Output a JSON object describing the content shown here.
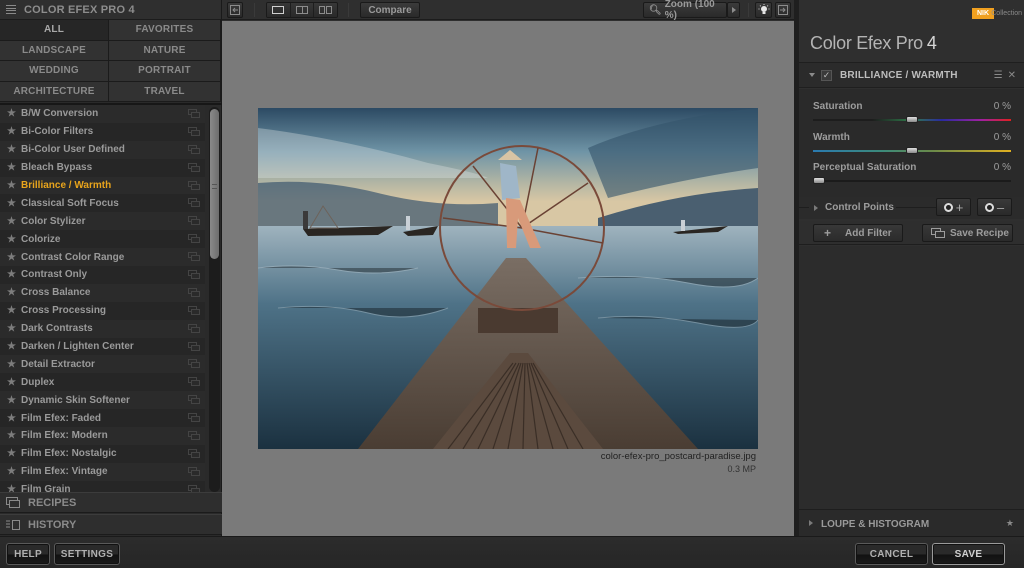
{
  "left_panel": {
    "title": "COLOR EFEX PRO 4",
    "categories": [
      {
        "label": "ALL",
        "active": true
      },
      {
        "label": "FAVORITES",
        "active": false
      },
      {
        "label": "LANDSCAPE",
        "active": false
      },
      {
        "label": "NATURE",
        "active": false
      },
      {
        "label": "WEDDING",
        "active": false
      },
      {
        "label": "PORTRAIT",
        "active": false
      },
      {
        "label": "ARCHITECTURE",
        "active": false
      },
      {
        "label": "TRAVEL",
        "active": false
      }
    ],
    "filters": [
      "B/W Conversion",
      "Bi-Color Filters",
      "Bi-Color User Defined",
      "Bleach Bypass",
      "Brilliance / Warmth",
      "Classical Soft Focus",
      "Color Stylizer",
      "Colorize",
      "Contrast Color Range",
      "Contrast Only",
      "Cross Balance",
      "Cross Processing",
      "Dark Contrasts",
      "Darken / Lighten Center",
      "Detail Extractor",
      "Duplex",
      "Dynamic Skin Softener",
      "Film Efex: Faded",
      "Film Efex: Modern",
      "Film Efex: Nostalgic",
      "Film Efex: Vintage",
      "Film Grain"
    ],
    "selected_filter": "Brilliance / Warmth",
    "selected_color": "#e8a41c",
    "recipes_label": "RECIPES",
    "history_label": "HISTORY"
  },
  "toolbar": {
    "compare_label": "Compare",
    "zoom_label": "Zoom (100 %)"
  },
  "canvas": {
    "filename": "color-efex-pro_postcard-paradise.jpg",
    "size": "0.3 MP"
  },
  "right_panel": {
    "brand_badge": "NIK",
    "brand_sub": "Collection",
    "app_title": "Color Efex Pro",
    "app_version": "4",
    "filter_title": "BRILLIANCE / WARMTH",
    "filter_enabled": true,
    "sliders": [
      {
        "label": "Saturation",
        "value": "0 %",
        "position": 0.5
      },
      {
        "label": "Warmth",
        "value": "0 %",
        "position": 0.5
      },
      {
        "label": "Perceptual Saturation",
        "value": "0 %",
        "position": 0.0
      }
    ],
    "control_points_label": "Control Points",
    "add_filter_label": "Add Filter",
    "save_recipe_label": "Save Recipe",
    "loupe_label": "LOUPE & HISTOGRAM"
  },
  "bottom_bar": {
    "help_label": "HELP",
    "settings_label": "SETTINGS",
    "cancel_label": "CANCEL",
    "save_label": "SAVE"
  }
}
